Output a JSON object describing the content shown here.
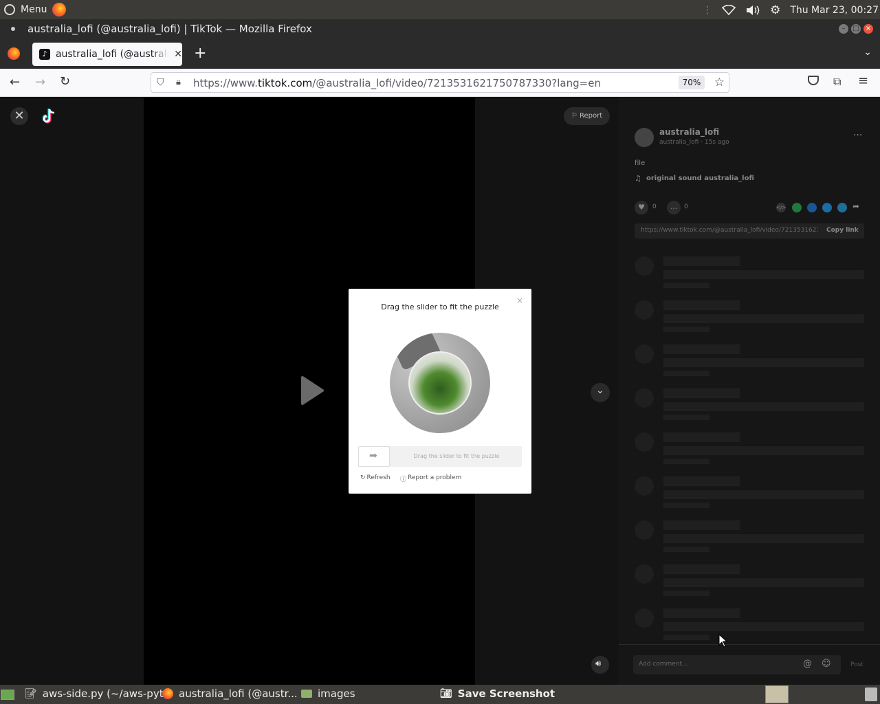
{
  "os": {
    "menu_label": "Menu",
    "clock": "Thu Mar 23, 00:27"
  },
  "window": {
    "title": "australia_lofi (@australia_lofi) | TikTok — Mozilla Firefox"
  },
  "tab": {
    "title": "australia_lofi (@australia_lofi) | TikTok"
  },
  "nav": {
    "url_prefix": "https://www.",
    "url_domain": "tiktok.com",
    "url_rest": "/@australia_lofi/video/7213531621750787330?lang=en",
    "zoom": "70%"
  },
  "video": {
    "report_label": "Report"
  },
  "panel": {
    "username": "australia_lofi",
    "subline": "australia_lofi · 15s ago",
    "caption": "file",
    "sound": "original sound australia_lofi",
    "likes": "0",
    "comments": "0",
    "share_link": "https://www.tiktok.com/@australia_lofi/video/721353162175...",
    "copy_link": "Copy link",
    "comment_placeholder": "Add comment...",
    "post_label": "Post"
  },
  "captcha": {
    "title": "Drag the slider to fit the puzzle",
    "slider_hint": "Drag the slider to fit the puzzle",
    "refresh_label": "Refresh",
    "report_label": "Report a problem"
  },
  "taskbar": {
    "item1": "aws-side.py (~/aws-pyt...",
    "item2": "australia_lofi (@austr...",
    "item3": "images",
    "item4": "Save Screenshot"
  }
}
